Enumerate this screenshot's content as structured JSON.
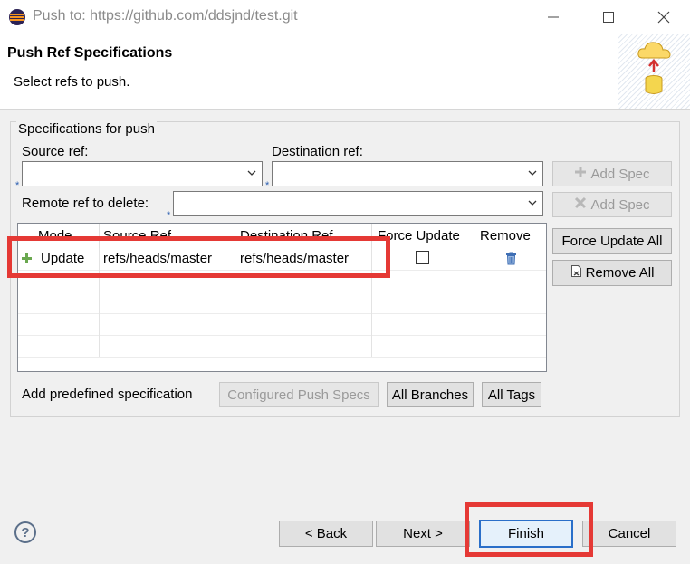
{
  "window": {
    "title": "Push to: https://github.com/ddsjnd/test.git",
    "minimize_icon": "minimize-icon",
    "maximize_icon": "maximize-icon",
    "close_icon": "close-icon"
  },
  "header": {
    "title": "Push Ref Specifications",
    "subtitle": "Select refs to push.",
    "icon": "push-cloud-database-icon"
  },
  "group": {
    "legend": "Specifications for push",
    "source_ref_label": "Source ref:",
    "source_ref_value": "",
    "destination_ref_label": "Destination ref:",
    "destination_ref_value": "",
    "remote_delete_label": "Remote ref to delete:",
    "remote_delete_value": "",
    "required_marker": "*",
    "add_spec_label": "Add Spec",
    "add_spec_delete_label": "Add Spec",
    "force_update_all_label": "Force Update All",
    "remove_all_label": "Remove All"
  },
  "table": {
    "columns": [
      "Mode",
      "Source Ref",
      "Destination Ref",
      "Force Update",
      "Remove"
    ],
    "rows": [
      {
        "mode": "Update",
        "source": "refs/heads/master",
        "destination": "refs/heads/master",
        "force_update": false,
        "remove_icon": "trash-icon"
      }
    ]
  },
  "predefined": {
    "label": "Add predefined specification",
    "configured_label": "Configured Push Specs",
    "all_branches_label": "All Branches",
    "all_tags_label": "All Tags"
  },
  "footer": {
    "help_icon": "help-icon",
    "help_glyph": "?",
    "back_label": "< Back",
    "next_label": "Next >",
    "finish_label": "Finish",
    "cancel_label": "Cancel"
  },
  "colors": {
    "highlight": "#e53935",
    "accent": "#2a6fc9"
  }
}
